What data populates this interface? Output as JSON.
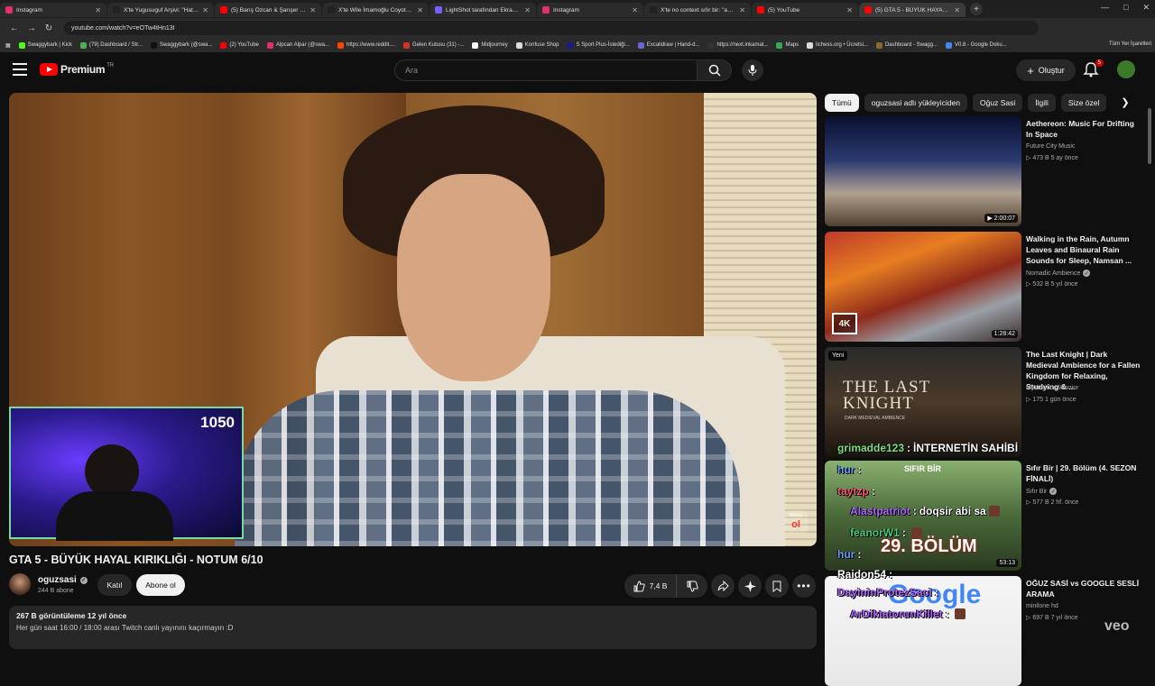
{
  "browser": {
    "tabs": [
      {
        "label": "Instagram",
        "color": "#e1306c"
      },
      {
        "label": "X'te Yugusuguf Arşivi: \"Hatalı dı",
        "color": "#222222"
      },
      {
        "label": "(5) Barış Özcan & Şarışer - Kon",
        "color": "#ff0000"
      },
      {
        "label": "X'te Wile İmamoğlu Coyote ◆",
        "color": "#222222"
      },
      {
        "label": "LightShot tarafından Ekran Gör",
        "color": "#7b5cff"
      },
      {
        "label": "Instagram",
        "color": "#e1306c"
      },
      {
        "label": "X'te no context sıfır bir: \"açlığa",
        "color": "#222222"
      },
      {
        "label": "(5) YouTube",
        "color": "#ff0000"
      },
      {
        "label": "(5) GTA 5 - BÜYÜK HAYAL K",
        "color": "#ff0000"
      }
    ],
    "url": "youtube.com/watch?v=eOTw4tHn13I",
    "bookmarks": [
      {
        "label": "Swaggybark | Kick",
        "color": "#53fc18"
      },
      {
        "label": "(79) Dashboard / Str...",
        "color": "#4caf50"
      },
      {
        "label": "Swaggybark (@swa...",
        "color": "#111111"
      },
      {
        "label": "(2) YouTube",
        "color": "#ff0000"
      },
      {
        "label": "Alpcan Alpar (@swa...",
        "color": "#e1306c"
      },
      {
        "label": "https://www.reddit....",
        "color": "#ff4500"
      },
      {
        "label": "Gelen Kutusu (31) -...",
        "color": "#d93025"
      },
      {
        "label": "Midjourney",
        "color": "#ffffff"
      },
      {
        "label": "Konfuse Shop",
        "color": "#dddddd"
      },
      {
        "label": "S Sport Plus-İstediği...",
        "color": "#1a1a8a"
      },
      {
        "label": "Excalidraw | Hand-d...",
        "color": "#6965db"
      },
      {
        "label": "https://next.inkamat...",
        "color": "#333333"
      },
      {
        "label": "Maps",
        "color": "#34a853"
      },
      {
        "label": "lichess.org • Ücretsi...",
        "color": "#dddddd"
      },
      {
        "label": "Dashboard - Swagg...",
        "color": "#8a6a2a"
      },
      {
        "label": "V0.8 - Google Doku...",
        "color": "#4285f4"
      }
    ],
    "bookmarks_right": "Tüm Yer İşaretleri"
  },
  "header": {
    "logo_text": "Premium",
    "logo_region": "TR",
    "search_placeholder": "Ara",
    "create_label": "Oluştur",
    "notification_count": "5"
  },
  "video": {
    "title": "GTA 5 - BÜYÜK HAYAL KIRIKLIĞI - NOTUM 6/10",
    "overlay_count": "1050",
    "watermark_top": "Abone",
    "watermark_bottom": "ol"
  },
  "channel": {
    "name": "oguzsasi",
    "subscribers": "244 B abone",
    "join_label": "Katıl",
    "subscribe_label": "Abone ol"
  },
  "actions": {
    "likes": "7,4 B"
  },
  "description": {
    "views_line": "267 B görüntüleme  12 yıl önce",
    "text_line": "Her gün saat 16:00 / 18:00 arası Twitch canlı yayınını kaçırmayın :D"
  },
  "chips": [
    "Tümü",
    "oguzsasi adlı yükleyiciden",
    "Oğuz Sasi",
    "İlgili",
    "Size özel"
  ],
  "recommendations": [
    {
      "title": "Aethereon: Music For Drifting In Space",
      "channel": "Future City Music",
      "verified": false,
      "meta": "▷ 473 B   5 ay önce",
      "duration": "▶ 2:00:07",
      "badge": ""
    },
    {
      "title": "Walking in the Rain, Autumn Leaves and Binaural Rain Sounds for Sleep, Namsan ...",
      "channel": "Nomadic Ambience",
      "verified": true,
      "meta": "▷ 532 B   5 yıl önce",
      "duration": "1:28:42",
      "badge": "4K"
    },
    {
      "title": "The Last Knight | Dark Medieval Ambience for a Fallen Kingdom for Relaxing, Studying & ...",
      "channel": "Mysterious Warrior",
      "verified": false,
      "meta": "▷ 175   1 gün önce",
      "duration": "",
      "badge": "Yeni"
    },
    {
      "title": "Sıfır Bir | 29. Bölüm (4. SEZON FİNALİ)",
      "channel": "Sıfır Bir",
      "verified": true,
      "meta": "▷ 577 B   2 hf. önce",
      "duration": "53:13",
      "badge": ""
    },
    {
      "title": "OĞUZ SASİ vs GOOGLE SESLİ ARAMA",
      "channel": "minilone hd",
      "verified": false,
      "meta": "▷ 697 B   7 yıl önce",
      "duration": "",
      "badge": ""
    }
  ],
  "thumb_text": {
    "knight": "THE LAST KNIGHT",
    "knight_sub": "DARK MEDIEVAL AMBIENCE",
    "sifir_top": "SIFIR BİR",
    "sifir_bottom": "29. BÖLÜM",
    "google": "Google"
  },
  "chat_overlay": [
    {
      "user": "grimadde123",
      "text": "İNTERNETİN SAHİBİ",
      "color": "#7fe07f"
    },
    {
      "user": "hur",
      "text": "",
      "color": "#6aa0ff"
    },
    {
      "user": "taytzp",
      "text": "",
      "color": "#ff5577"
    },
    {
      "user": "Alastpatriot",
      "text": "doqsir abi sa",
      "color": "#b066ff"
    },
    {
      "user": "feanorW1",
      "text": "",
      "color": "#44d17a"
    },
    {
      "user": "hur",
      "text": "",
      "color": "#6aa0ff"
    },
    {
      "user": "Raidon54",
      "text": "",
      "color": "#ffffff"
    },
    {
      "user": "DayininProtezSaci",
      "text": "",
      "color": "#b066ff"
    },
    {
      "user": "ArDiktatorunKillet",
      "text": "",
      "color": "#b066ff"
    }
  ],
  "colors": {
    "accent": "#ff0000",
    "background": "#0f0f0f"
  }
}
